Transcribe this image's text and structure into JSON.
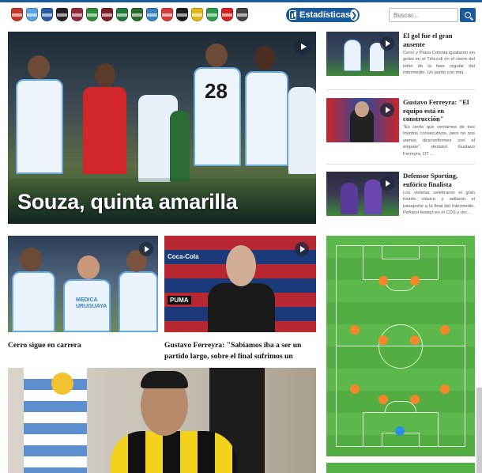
{
  "header": {
    "crests": [
      {
        "name": "crest-1",
        "color": "#c0392b"
      },
      {
        "name": "crest-2",
        "color": "#5aa3e0"
      },
      {
        "name": "crest-3",
        "color": "#2c5aa0"
      },
      {
        "name": "crest-4",
        "color": "#222222"
      },
      {
        "name": "crest-5",
        "color": "#8e2c3c"
      },
      {
        "name": "crest-6",
        "color": "#2e8b3c"
      },
      {
        "name": "crest-7",
        "color": "#7a1f2b"
      },
      {
        "name": "crest-8",
        "color": "#1f7a3a"
      },
      {
        "name": "crest-9",
        "color": "#2a6a2a"
      },
      {
        "name": "crest-10",
        "color": "#3a7fc0"
      },
      {
        "name": "crest-11",
        "color": "#d63a3a"
      },
      {
        "name": "crest-12",
        "color": "#1c1c1c"
      },
      {
        "name": "crest-13",
        "color": "#e3b91a"
      },
      {
        "name": "crest-14",
        "color": "#2e9a4a"
      },
      {
        "name": "crest-15",
        "color": "#d62020"
      },
      {
        "name": "crest-16",
        "color": "#444444"
      }
    ],
    "stats_label": "Estadísticas",
    "search_placeholder": "Buscar..."
  },
  "hero": {
    "title": "Souza, quinta amarilla"
  },
  "sidebar": {
    "items": [
      {
        "title": "El gol fue el gran ausente",
        "desc": "Cerro y Plaza Colonia igualaron sin goles en el Tróccoli en el cierre del telón de la fase regular del Intermedio. Un punto con mej..."
      },
      {
        "title": "Gustavo Ferreyra: \"El equipo está en construcción\"",
        "desc": "\"Es cierto que veníamos de tres triunfos consecutivos, pero no nos vamos desconformes con el empate\", destacó Gustavo Ferreyra, DT ..."
      },
      {
        "title": "Defensor Sporting, eufórico finalista",
        "desc": "Los violetas celebraron el gran triunfo clásico y sellaron el pasaporte a la final del Intermedio. Peñarol festejó en el CDS y rec..."
      }
    ]
  },
  "mid": {
    "left_caption": "Cerro sigue en carrera",
    "right_caption": "Gustavo Ferreyra: \"Sabíamos iba a ser un partido largo, sobre el final sufrimos un"
  },
  "photo_texts": {
    "hero_shirt_number": "28",
    "jersey_sponsor": "MEDICA URUGUAYA",
    "ad_1": "Coca-Cola",
    "ad_2": "PUMA"
  },
  "colors": {
    "brand_blue": "#1a5a9a",
    "pitch_green": "#5cb84a",
    "player_dot": "#f5872a",
    "goalkeeper_dot": "#2b8fe8"
  }
}
